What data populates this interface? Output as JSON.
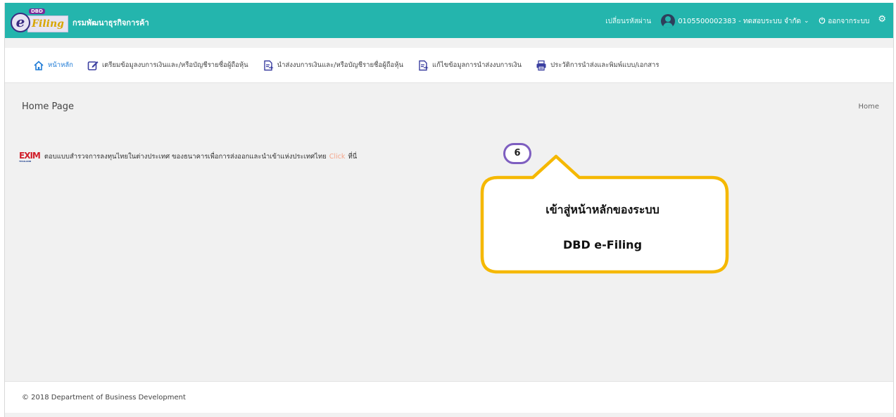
{
  "app": {
    "logo_dbd": "DBD",
    "logo_e": "e",
    "logo_filing": "Filing",
    "title": "กรมพัฒนาธุรกิจการค้า"
  },
  "topbar": {
    "change_password": "เปลี่ยนรหัสผ่าน",
    "user": "0105500002383 - ทดสอบระบบ จำกัด",
    "logout": "ออกจากระบบ"
  },
  "nav": {
    "items": [
      {
        "label": "หน้าหลัก",
        "icon": "home-icon"
      },
      {
        "label": "เตรียมข้อมูลงบการเงินและ/หรือบัญชีรายชื่อผู้ถือหุ้น",
        "icon": "edit-icon"
      },
      {
        "label": "นำส่งงบการเงินและ/หรือบัญชีรายชื่อผู้ถือหุ้น",
        "icon": "document-submit-icon"
      },
      {
        "label": "แก้ไขข้อมูลการนำส่งงบการเงิน",
        "icon": "document-edit-icon"
      },
      {
        "label": "ประวัติการนำส่งและพิมพ์แบบ/เอกสาร",
        "icon": "printer-icon"
      }
    ]
  },
  "page": {
    "title": "Home Page",
    "breadcrumb": "Home"
  },
  "notice": {
    "logo": "EXIM",
    "logo_sub": "THAILAND",
    "text": "ตอบแบบสำรวจการลงทุนไทยในต่างประเทศ ของธนาคารเพื่อการส่งออกและนำเข้าแห่งประเทศไทย",
    "link": "Click",
    "suffix": "ที่นี่"
  },
  "annotation": {
    "step": "6",
    "line1": "เข้าสู่หน้าหลักของระบบ",
    "line2": "DBD e-Filing"
  },
  "footer": {
    "text": "© 2018 Department of Business Development"
  },
  "colors": {
    "topbar": "#24b5ad",
    "nav_active": "#1f7bd6",
    "callout_border": "#f5b800",
    "badge_border": "#7e5ec0",
    "link": "#f4a58a"
  }
}
